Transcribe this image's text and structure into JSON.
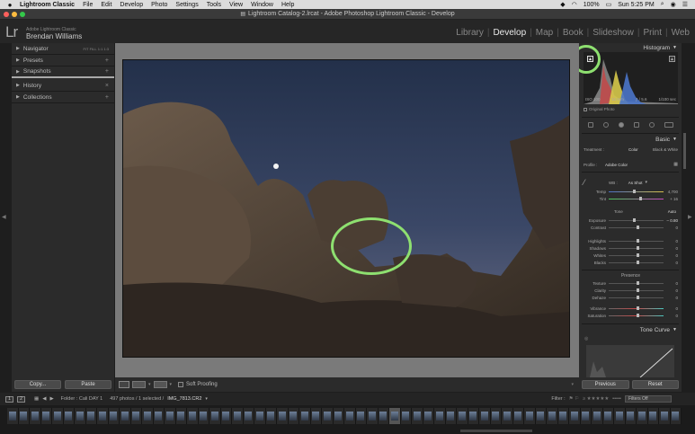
{
  "menubar": {
    "app_name": "Lightroom Classic",
    "items": [
      "File",
      "Edit",
      "Develop",
      "Photo",
      "Settings",
      "Tools",
      "View",
      "Window",
      "Help"
    ],
    "battery": "100%",
    "clock": "Sun 5:25 PM"
  },
  "window": {
    "title": "Lightroom Catalog-2.lrcat - Adobe Photoshop Lightroom Classic - Develop"
  },
  "identity": {
    "logo": "Lr",
    "catalog_owner": "Adobe Lightroom Classic",
    "user": "Brendan Williams"
  },
  "modules": {
    "items": [
      "Library",
      "Develop",
      "Map",
      "Book",
      "Slideshow",
      "Print",
      "Web"
    ],
    "active": "Develop"
  },
  "left_panel": {
    "navigator": {
      "label": "Navigator",
      "zoom": [
        "FIT",
        "FILL",
        "1:1",
        "1:3"
      ]
    },
    "presets": {
      "label": "Presets"
    },
    "snapshots": {
      "label": "Snapshots"
    },
    "history": {
      "label": "History"
    },
    "collections": {
      "label": "Collections"
    },
    "copy_label": "Copy...",
    "paste_label": "Paste"
  },
  "toolbar": {
    "soft_proofing": "Soft Proofing"
  },
  "right_panel": {
    "histogram": {
      "label": "Histogram",
      "iso": "ISO 100",
      "focal": "11 mm",
      "aperture": "ƒ / 5.6",
      "shutter": "1/100 sec",
      "original_photo": "Original Photo"
    },
    "basic": {
      "label": "Basic",
      "treatment_label": "Treatment :",
      "treatment_color": "Color",
      "treatment_bw": "Black & White",
      "profile_label": "Profile :",
      "profile_value": "Adobe Color",
      "wb_label": "WB :",
      "wb_value": "As Shot",
      "temp_label": "Temp",
      "temp_value": "4,700",
      "tint_label": "Tint",
      "tint_value": "+ 16",
      "tone_label": "Tone",
      "auto_label": "Auto",
      "exposure_label": "Exposure",
      "exposure_value": "– 0.80",
      "contrast_label": "Contrast",
      "contrast_value": "0",
      "highlights_label": "Highlights",
      "highlights_value": "0",
      "shadows_label": "Shadows",
      "shadows_value": "0",
      "whites_label": "Whites",
      "whites_value": "0",
      "blacks_label": "Blacks",
      "blacks_value": "0",
      "presence_label": "Presence",
      "texture_label": "Texture",
      "texture_value": "0",
      "clarity_label": "Clarity",
      "clarity_value": "0",
      "dehaze_label": "Dehaze",
      "dehaze_value": "0",
      "vibrance_label": "Vibrance",
      "vibrance_value": "0",
      "saturation_label": "Saturation",
      "saturation_value": "0"
    },
    "tone_curve": {
      "label": "Tone Curve"
    },
    "previous_label": "Previous",
    "reset_label": "Reset"
  },
  "filmstrip_header": {
    "source": "Folder : Cali DAY 1",
    "count": "497 photos / 1 selected /",
    "filename": "IMG_7813.CR2",
    "filter_label": "Filter :",
    "filters_off": "Filters Off"
  },
  "colors": {
    "accent_highlight": "#8ee070",
    "panel_bg": "#2b2b2b",
    "active_module": "#e9e9e9"
  }
}
